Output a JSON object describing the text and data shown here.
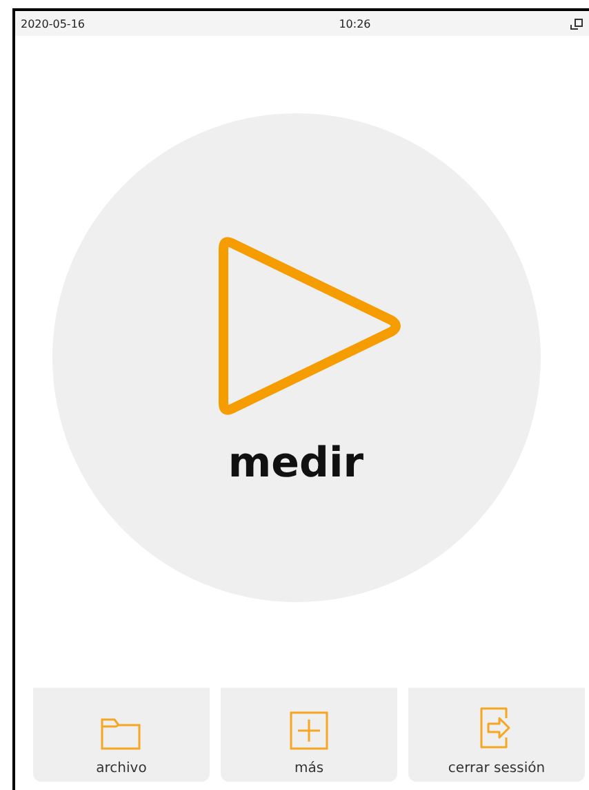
{
  "status_bar": {
    "date": "2020-05-16",
    "time": "10:26"
  },
  "main_button": {
    "label": "medir"
  },
  "buttons": [
    {
      "kind": "folder",
      "label": "archivo"
    },
    {
      "kind": "plus",
      "label": "más"
    },
    {
      "kind": "logout",
      "label": "cerrar sessión"
    }
  ]
}
